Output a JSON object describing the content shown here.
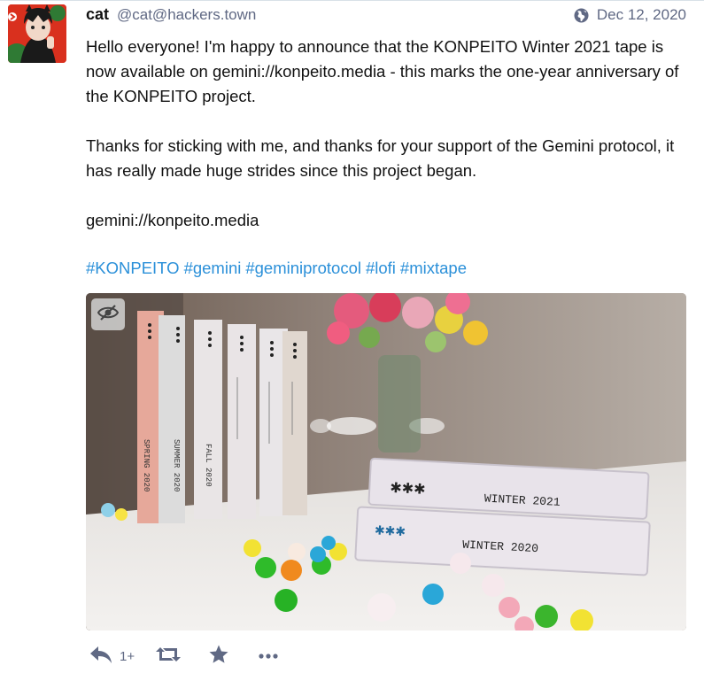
{
  "status": {
    "display_name": "cat",
    "account": "@cat@hackers.town",
    "date": "Dec 12, 2020",
    "paragraphs": [
      "Hello everyone! I'm happy to announce that the KONPEITO Winter 2021 tape is now available on gemini://konpeito.media - this marks the one-year anniversary of the KONPEITO project.",
      "Thanks for sticking with me, and thanks for your support of the Gemini protocol, it has really made huge strides since this project began.",
      "gemini://konpeito.media"
    ],
    "hashtags": [
      "#KONPEITO",
      "#gemini",
      "#geminiprotocol",
      "#lofi",
      "#mixtape"
    ],
    "media": {
      "tapes_back": [
        "SPRING 2020",
        "SUMMER 2020",
        "FALL 2020",
        "",
        "",
        ""
      ],
      "tape_front_top": "WINTER 2021",
      "tape_front_bottom": "WINTER 2020"
    },
    "actions": {
      "reply_count": "1+"
    }
  },
  "icons": {
    "visibility": "globe-icon",
    "media_toggle": "eye-slash-icon",
    "reply": "reply-icon",
    "boost": "retweet-icon",
    "favourite": "star-icon",
    "more": "ellipsis-icon"
  },
  "colors": {
    "link": "#2b90d9",
    "muted": "#606984",
    "text": "#111111"
  }
}
